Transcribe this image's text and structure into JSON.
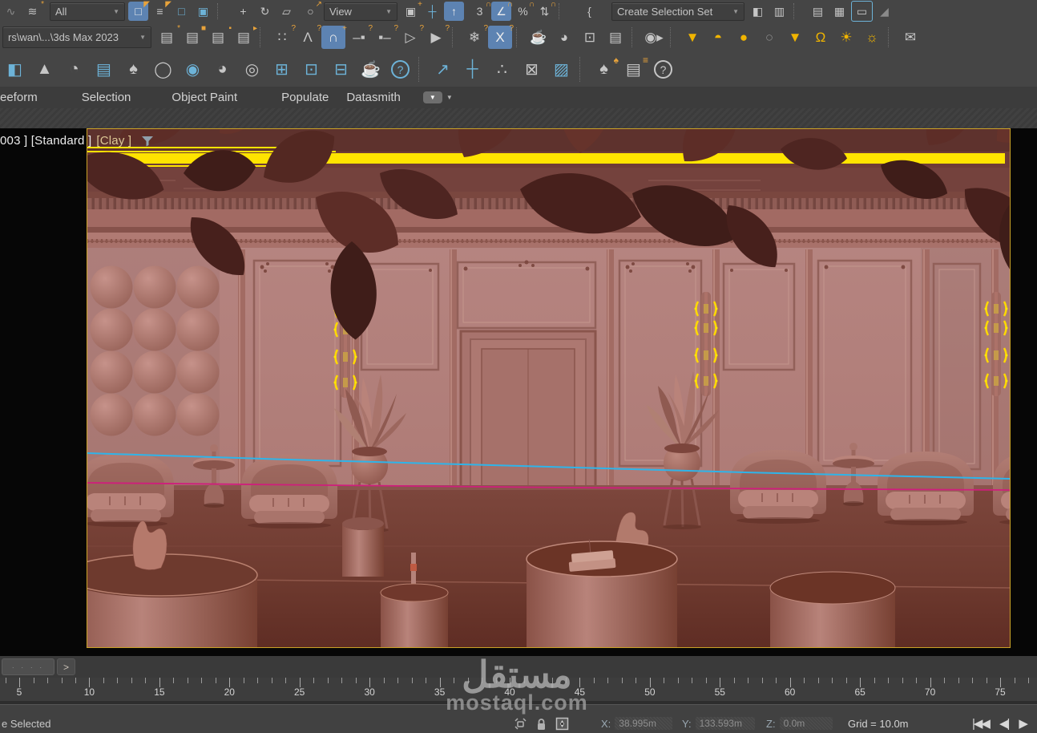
{
  "colors": {
    "toolbar_bg": "#454545",
    "active_blue": "#5d83b2",
    "icon_yellow": "#f0b400",
    "viewport_border": "#c9a227",
    "light_strip_yellow": "#ffe400",
    "sconce_glow": "#ffd900",
    "spline_blue": "#2fb4e9",
    "spline_magenta": "#cf1e7c",
    "clay_wall": "#b4827e",
    "clay_floor": "#6d392e",
    "clay_leaves": "#4e2521"
  },
  "toolbar_row1": [
    {
      "name": "select-and-link-icon",
      "glyph": "∿",
      "color": "dim"
    },
    {
      "name": "unlink-selection-icon",
      "glyph": "≋",
      "accent": "*"
    },
    {
      "type": "select",
      "name": "selection-filter-dropdown",
      "value": "All"
    },
    {
      "name": "select-object-button",
      "glyph": "□",
      "accent": "◤",
      "active": true
    },
    {
      "name": "select-by-name-button",
      "glyph": "≡",
      "accent": "◤"
    },
    {
      "name": "rectangular-selection-region-button",
      "glyph": "□",
      "color": "blue"
    },
    {
      "name": "window-crossing-toggle",
      "glyph": "▣",
      "color": "blue"
    },
    {
      "type": "sep"
    },
    {
      "name": "select-and-move-button",
      "glyph": "+"
    },
    {
      "name": "select-and-rotate-button",
      "glyph": "↻"
    },
    {
      "name": "select-and-scale-button",
      "glyph": "▱"
    },
    {
      "name": "select-and-place-button",
      "glyph": "○",
      "accent": "↗"
    },
    {
      "type": "select",
      "name": "reference-coordinate-system-dropdown",
      "value": "View"
    },
    {
      "name": "use-pivot-point-center-button",
      "glyph": "▣",
      "accent": "+"
    },
    {
      "name": "select-and-manipulate-button",
      "glyph": "┼",
      "color": "blue"
    },
    {
      "name": "keyboard-shortcut-override-toggle",
      "glyph": "↑",
      "active": true
    },
    {
      "name": "snap-toggle-3d-button",
      "glyph": "3",
      "accent": "∩"
    },
    {
      "name": "angle-snap-toggle",
      "glyph": "∠",
      "accent": "∩",
      "active": true
    },
    {
      "name": "percent-snap-toggle",
      "glyph": "%",
      "accent": "∩"
    },
    {
      "name": "spinner-snap-toggle",
      "glyph": "⇅",
      "accent": "∩"
    },
    {
      "type": "sep"
    },
    {
      "name": "edit-named-selection-sets-button",
      "glyph": "{"
    },
    {
      "type": "select",
      "name": "create-selection-set-dropdown",
      "value": "Create Selection Set"
    },
    {
      "name": "mirror-button",
      "glyph": "◧"
    },
    {
      "name": "align-button",
      "glyph": "▥"
    },
    {
      "type": "sep"
    },
    {
      "name": "layer-explorer-button",
      "glyph": "▤"
    },
    {
      "name": "manage-layers-button",
      "glyph": "▦"
    },
    {
      "name": "scene-explorer-toggle",
      "glyph": "▭",
      "framed": true
    },
    {
      "name": "curve-editor-button",
      "glyph": "◢",
      "color": "dim"
    }
  ],
  "toolbar_row2": [
    {
      "type": "select",
      "name": "project-folder-dropdown",
      "value": "rs\\wan\\...\\3ds Max 2023"
    },
    {
      "name": "macro-recorder-icon",
      "glyph": "▤",
      "accent": "*"
    },
    {
      "name": "open-script-icon",
      "glyph": "▤",
      "accent": "■"
    },
    {
      "name": "script-links-icon",
      "glyph": "▤",
      "accent": "▪"
    },
    {
      "name": "edit-script-icon",
      "glyph": "▤",
      "accent": "▸"
    },
    {
      "type": "sep"
    },
    {
      "name": "grid-points-icon",
      "glyph": "∷",
      "accent": "?"
    },
    {
      "name": "ik-chain-icon",
      "glyph": "Λ",
      "accent": "?"
    },
    {
      "name": "snaps-toggle-button",
      "glyph": "∩",
      "accent": "+",
      "active": true
    },
    {
      "name": "slider-min-icon",
      "glyph": "–▪",
      "accent": "?"
    },
    {
      "name": "slider-max-icon",
      "glyph": "▪–",
      "accent": "?"
    },
    {
      "name": "arrow-outline-icon",
      "glyph": "▷",
      "accent": "?"
    },
    {
      "name": "arrow-filled-icon",
      "glyph": "▶",
      "accent": "?"
    },
    {
      "type": "sep"
    },
    {
      "name": "freeze-snowflake-icon",
      "glyph": "❄",
      "accent": "?"
    },
    {
      "name": "xform-toggle-button",
      "glyph": "X",
      "accent": "?",
      "active": true
    },
    {
      "type": "sep"
    },
    {
      "name": "teapot-render-icon",
      "glyph": "☕"
    },
    {
      "name": "render-iterative-icon",
      "glyph": "◕"
    },
    {
      "name": "render-setup-icon",
      "glyph": "⊡"
    },
    {
      "name": "render-presets-icon",
      "glyph": "▤"
    },
    {
      "type": "sep"
    },
    {
      "name": "video-camera-icon",
      "glyph": "◉▸"
    },
    {
      "type": "sep"
    },
    {
      "name": "target-spot-light-icon",
      "glyph": "▼",
      "color": "yellow"
    },
    {
      "name": "dome-light-icon",
      "glyph": "◓",
      "color": "yellow"
    },
    {
      "name": "sphere-light-icon",
      "glyph": "●",
      "color": "yellow"
    },
    {
      "name": "geodesic-sphere-icon",
      "glyph": "○",
      "color": "dim"
    },
    {
      "name": "target-light-icon",
      "glyph": "▼",
      "color": "yellow"
    },
    {
      "name": "free-light-icon",
      "glyph": "Ω",
      "color": "yellow"
    },
    {
      "name": "sun-positioner-icon",
      "glyph": "☀",
      "color": "yellow"
    },
    {
      "name": "sun-rays-icon",
      "glyph": "☼",
      "color": "yellow"
    },
    {
      "type": "sep"
    },
    {
      "name": "envelope-icon",
      "glyph": "✉"
    }
  ],
  "toolbar_row3": [
    {
      "name": "edge-partial-icon",
      "glyph": "◧",
      "color": "blue"
    },
    {
      "name": "terrain-icon",
      "glyph": "▲"
    },
    {
      "name": "boolean-saw-icon",
      "glyph": "◔"
    },
    {
      "name": "list-document-icon",
      "glyph": "▤",
      "color": "blue"
    },
    {
      "name": "tree-cutout-icon",
      "glyph": "♠"
    },
    {
      "name": "fire-ring-icon",
      "glyph": "◯"
    },
    {
      "name": "layered-spheres-icon",
      "glyph": "◉",
      "color": "blue"
    },
    {
      "name": "palette-icon",
      "glyph": "◕"
    },
    {
      "name": "lightbulb-icon",
      "glyph": "◎"
    },
    {
      "name": "window-columns-icon",
      "glyph": "⊞",
      "color": "blue"
    },
    {
      "name": "window-play-icon",
      "glyph": "⊡",
      "color": "blue"
    },
    {
      "name": "window-split-icon",
      "glyph": "⊟",
      "color": "blue"
    },
    {
      "name": "teapot-preview-icon",
      "glyph": "☕"
    },
    {
      "name": "help-button",
      "glyph": "?",
      "circle": true,
      "color": "blue"
    },
    {
      "type": "sep"
    },
    {
      "name": "transform-out-icon",
      "glyph": "↗",
      "color": "blue"
    },
    {
      "name": "pivot-target-icon",
      "glyph": "┼",
      "color": "blue"
    },
    {
      "name": "scatter-spheres-icon",
      "glyph": "∴"
    },
    {
      "name": "paint-objects-icon",
      "glyph": "⊠"
    },
    {
      "name": "expand-squares-icon",
      "glyph": "▨",
      "color": "blue"
    },
    {
      "type": "sep"
    },
    {
      "name": "forest-trees-icon",
      "glyph": "♠",
      "accent": "♠"
    },
    {
      "name": "lines-document-icon",
      "glyph": "▤",
      "accent": "≡"
    },
    {
      "name": "help2-button",
      "glyph": "?",
      "circle": true
    }
  ],
  "ribbon": {
    "tabs": [
      {
        "name": "tab-freeform",
        "label": "eeform"
      },
      {
        "name": "tab-selection",
        "label": "Selection"
      },
      {
        "name": "tab-object-paint",
        "label": "Object Paint"
      },
      {
        "name": "tab-populate",
        "label": "Populate"
      },
      {
        "name": "tab-datasmith",
        "label": "Datasmith"
      }
    ],
    "overflow_icon": "▼"
  },
  "viewport": {
    "label_camera": "003 ]",
    "label_style": "[Standard ]",
    "label_mode": "[Clay ]"
  },
  "trackbar": {
    "slider_dots": "· · · ·",
    "next_frame": ">"
  },
  "timeline": {
    "frame_numbers": [
      5,
      10,
      15,
      20,
      25,
      30,
      35,
      40,
      45,
      50,
      55,
      60,
      65,
      70,
      75
    ]
  },
  "statusbar": {
    "selected_text": "e Selected",
    "icons": [
      "isolate-selection-icon",
      "selection-lock-icon",
      "absolute-mode-icon"
    ],
    "x_label": "X:",
    "x_value": "38.995m",
    "y_label": "Y:",
    "y_value": "133.593m",
    "z_label": "Z:",
    "z_value": "0.0m",
    "grid_text": "Grid = 10.0m",
    "playback": [
      {
        "name": "go-to-start-button",
        "glyph": "|◀◀"
      },
      {
        "name": "previous-frame-button",
        "glyph": "◀|"
      },
      {
        "name": "play-button",
        "glyph": "▶"
      },
      {
        "name": "next-frame-button",
        "glyph": "|"
      }
    ]
  },
  "watermark": {
    "line1": "مستقل",
    "line2": "mostaql.com"
  }
}
